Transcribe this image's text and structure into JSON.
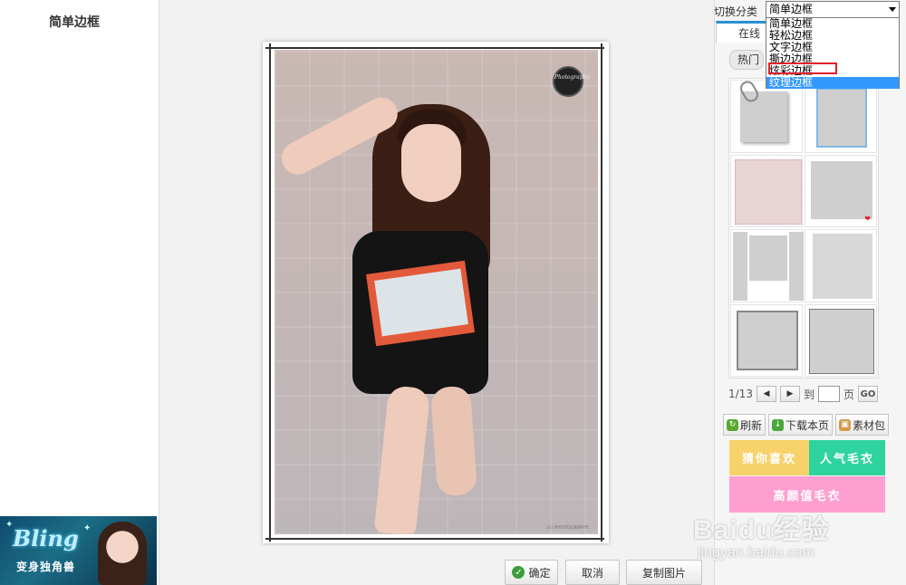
{
  "left_panel": {
    "title": "简单边框",
    "ad": {
      "brand": "Bling",
      "subtitle": "变身独角兽"
    }
  },
  "preview": {
    "photo_logo": "Photography",
    "photo_caption": "(c) PHOTOGRAPHY"
  },
  "actions": {
    "confirm": "确定",
    "cancel": "取消",
    "copy": "复制图片"
  },
  "right_panel": {
    "switch_label": "切换分类",
    "category_select": {
      "value": "简单边框",
      "options": [
        "简单边框",
        "轻松边框",
        "文字边框",
        "撕边边框",
        "炫彩边框",
        "纹理边框"
      ],
      "highlighted_option": "纹理边框",
      "boxed_option": "炫彩边框"
    },
    "tab_online": "在线素材",
    "hot_tab": "热门",
    "pager": {
      "current": "1/13",
      "goto_label": "到",
      "page_label": "页",
      "go": "GO"
    },
    "tools": {
      "refresh": "刷新",
      "download_page": "下载本页",
      "material_pack": "素材包"
    },
    "promos": {
      "guess": "猜你喜欢",
      "popular": "人气毛衣",
      "value": "高颜值毛衣"
    }
  },
  "watermark": {
    "brand": "Baidu经验",
    "url": "jingyan.baidu.com"
  },
  "colors": {
    "accent": "#2a8fd0",
    "selected": "#3399ff",
    "highlight_box": "#e0202a",
    "promo_yellow": "#f7d26a",
    "promo_green": "#2ed39e",
    "promo_pink": "#ff9fd0"
  }
}
